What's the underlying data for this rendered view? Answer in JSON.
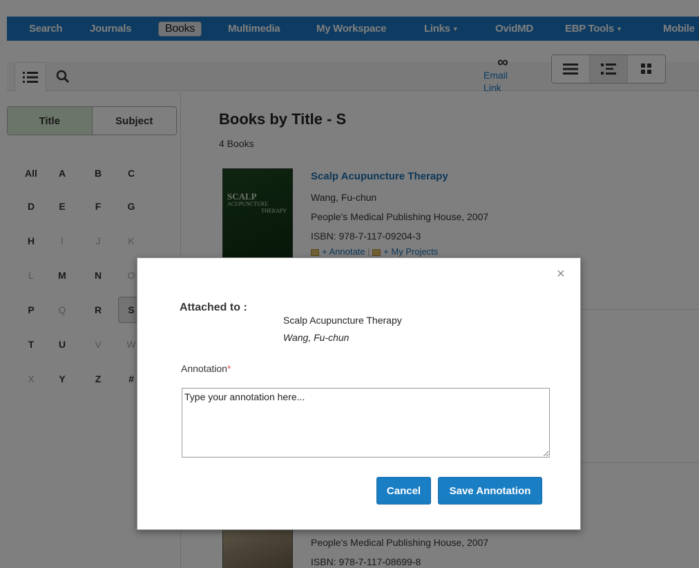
{
  "nav": {
    "items": [
      {
        "label": "Search"
      },
      {
        "label": "Journals"
      },
      {
        "label": "Books"
      },
      {
        "label": "Multimedia"
      },
      {
        "label": "My Workspace"
      },
      {
        "label": "Links"
      },
      {
        "label": "OvidMD"
      },
      {
        "label": "EBP Tools"
      },
      {
        "label": "Mobile"
      }
    ]
  },
  "toolbar": {
    "email_link": "Email Link"
  },
  "sidebar": {
    "tabs": {
      "title": "Title",
      "subject": "Subject"
    },
    "letters": [
      "All",
      "A",
      "B",
      "C",
      "D",
      "E",
      "F",
      "G",
      "H",
      "I",
      "J",
      "K",
      "L",
      "M",
      "N",
      "O",
      "P",
      "Q",
      "R",
      "S",
      "T",
      "U",
      "V",
      "W",
      "X",
      "Y",
      "Z",
      "#"
    ],
    "selected_letter": "S"
  },
  "main": {
    "heading": "Books by Title - S",
    "count": "4 Books",
    "books": [
      {
        "title": "Scalp Acupuncture Therapy",
        "author": "Wang, Fu-chun",
        "publisher": "People's Medical Publishing House, 2007",
        "isbn": "ISBN: 978-7-117-09204-3",
        "annotate": "Annotate",
        "projects": "My Projects",
        "cover": {
          "line1": "SCALP",
          "line2": "ACUPUNCTURE",
          "line3": "THERAPY"
        }
      },
      {
        "publisher": "People's Medical Publishing House, 2007",
        "isbn": "ISBN: 978-7-117-08699-8"
      }
    ]
  },
  "modal": {
    "attached_label": "Attached to :",
    "attached_title": "Scalp Acupuncture Therapy",
    "attached_author": "Wang, Fu-chun",
    "annotation_label": "Annotation",
    "required_mark": "*",
    "annotation_value": "Type your annotation here...",
    "cancel": "Cancel",
    "save": "Save Annotation",
    "close": "×"
  }
}
